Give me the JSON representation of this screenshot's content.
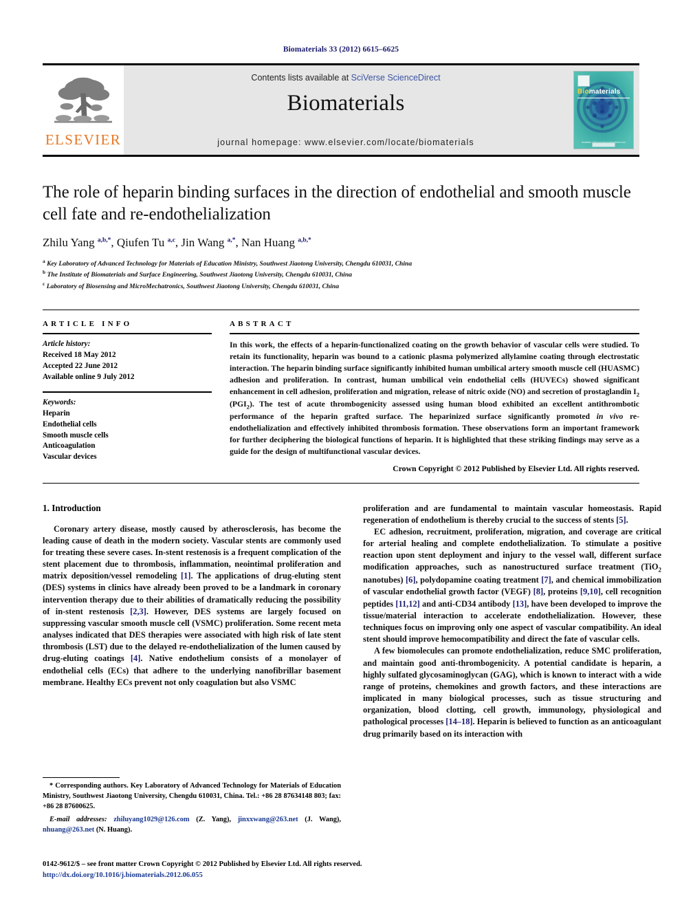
{
  "running_head": "Biomaterials 33 (2012) 6615–6625",
  "masthead": {
    "publisher_logo_word": "ELSEVIER",
    "contents_prefix": "Contents lists available at ",
    "contents_link": "SciVerse ScienceDirect",
    "journal_title": "Biomaterials",
    "homepage": "journal homepage: www.elsevier.com/locate/biomaterials",
    "cover": {
      "title_part1": "Bio",
      "title_part2": "materials",
      "footer_text": "Available online at www.sciencedirect.com",
      "teal": "#3aa8a0",
      "yellow": "#f4d03f"
    }
  },
  "article": {
    "title": "The role of heparin binding surfaces in the direction of endothelial and smooth muscle cell fate and re-endothelialization",
    "authors_html": "Zhilu Yang <sup>a,b,</sup><sup>*</sup>, Qiufen Tu <sup>a,c</sup>, Jin Wang <sup>a,</sup><sup>*</sup>, Nan Huang <sup>a,b,</sup><sup>*</sup>",
    "affiliations": [
      {
        "marker": "a",
        "text": "Key Laboratory of Advanced Technology for Materials of Education Ministry, Southwest Jiaotong University, Chengdu 610031, China"
      },
      {
        "marker": "b",
        "text": "The Institute of Biomaterials and Surface Engineering, Southwest Jiaotong University, Chengdu 610031, China"
      },
      {
        "marker": "c",
        "text": "Laboratory of Biosensing and MicroMechatronics, Southwest Jiaotong University, Chengdu 610031, China"
      }
    ]
  },
  "article_info": {
    "heading": "ARTICLE INFO",
    "history_label": "Article history:",
    "history": [
      "Received 18 May 2012",
      "Accepted 22 June 2012",
      "Available online 9 July 2012"
    ],
    "keywords_label": "Keywords:",
    "keywords": [
      "Heparin",
      "Endothelial cells",
      "Smooth muscle cells",
      "Anticoagulation",
      "Vascular devices"
    ]
  },
  "abstract": {
    "heading": "ABSTRACT",
    "text_html": "In this work, the effects of a heparin-functionalized coating on the growth behavior of vascular cells were studied. To retain its functionality, heparin was bound to a cationic plasma polymerized allylamine coating through electrostatic interaction. The heparin binding surface significantly inhibited human umbilical artery smooth muscle cell (HUASMC) adhesion and proliferation. In contrast, human umbilical vein endothelial cells (HUVECs) showed significant enhancement in cell adhesion, proliferation and migration, release of nitric oxide (NO) and secretion of prostaglandin I<sub>2</sub> (PGI<sub>2</sub>). The test of acute thrombogenicity assessed using human blood exhibited an excellent antithrombotic performance of the heparin grafted surface. The heparinized surface significantly promoted <i>in vivo</i> re-endothelialization and effectively inhibited thrombosis formation. These observations form an important framework for further deciphering the biological functions of heparin. It is highlighted that these striking findings may serve as a guide for the design of multifunctional vascular devices.",
    "copyright": "Crown Copyright © 2012 Published by Elsevier Ltd. All rights reserved."
  },
  "body": {
    "section_title": "1. Introduction",
    "left_paragraphs_html": [
      "Coronary artery disease, mostly caused by atherosclerosis, has become the leading cause of death in the modern society. Vascular stents are commonly used for treating these severe cases. In-stent restenosis is a frequent complication of the stent placement due to thrombosis, inflammation, neointimal proliferation and matrix deposition/vessel remodeling <span class=\"ref\">[1]</span>. The applications of drug-eluting stent (DES) systems in clinics have already been proved to be a landmark in coronary intervention therapy due to their abilities of dramatically reducing the possibility of in-stent restenosis <span class=\"ref\">[2,3]</span>. However, DES systems are largely focused on suppressing vascular smooth muscle cell (VSMC) proliferation. Some recent meta analyses indicated that DES therapies were associated with high risk of late stent thrombosis (LST) due to the delayed re-endothelialization of the lumen caused by drug-eluting coatings <span class=\"ref\">[4]</span>. Native endothelium consists of a monolayer of endothelial cells (ECs) that adhere to the underlying nanofibrillar basement membrane. Healthy ECs prevent not only coagulation but also VSMC"
    ],
    "right_paragraphs_html": [
      "proliferation and are fundamental to maintain vascular homeostasis. Rapid regeneration of endothelium is thereby crucial to the success of stents <span class=\"ref\">[5]</span>.",
      "EC adhesion, recruitment, proliferation, migration, and coverage are critical for arterial healing and complete endothelialization. To stimulate a positive reaction upon stent deployment and injury to the vessel wall, different surface modification approaches, such as nanostructured surface treatment (TiO<sub>2</sub> nanotubes) <span class=\"ref\">[6]</span>, polydopamine coating treatment <span class=\"ref\">[7]</span>, and chemical immobilization of vascular endothelial growth factor (VEGF) <span class=\"ref\">[8]</span>, proteins <span class=\"ref\">[9,10]</span>, cell recognition peptides <span class=\"ref\">[11,12]</span> and anti-CD34 antibody <span class=\"ref\">[13]</span>, have been developed to improve the tissue/material interaction to accelerate endothelialization. However, these techniques focus on improving only one aspect of vascular compatibility. An ideal stent should improve hemocompatibility and direct the fate of vascular cells.",
      "A few biomolecules can promote endothelialization, reduce SMC proliferation, and maintain good anti-thrombogenicity. A potential candidate is heparin, a highly sulfated glycosaminoglycan (GAG), which is known to interact with a wide range of proteins, chemokines and growth factors, and these interactions are implicated in many biological processes, such as tissue structuring and organization, blood clotting, cell growth, immunology, physiological and pathological processes <span class=\"ref\">[14–18]</span>. Heparin is believed to function as an anticoagulant drug primarily based on its interaction with"
    ]
  },
  "footnotes": {
    "corresponding_html": "<span class=\"lead\">*</span> Corresponding authors. Key Laboratory of Advanced Technology for Materials of Education Ministry, Southwest Jiaotong University, Chengdu 610031, China. Tel.: +86 28 87634148 803; fax: +86 28 87600625.",
    "email_label": "E-mail addresses:",
    "emails_html": "<span class=\"link\">zhiluyang1029@126.com</span> (Z. Yang), <span class=\"link\">jinxxwang@263.net</span> (J. Wang), <span class=\"link\">nhuang@263.net</span> (N. Huang)."
  },
  "bottom": {
    "issn_line": "0142-9612/$ – see front matter Crown Copyright © 2012 Published by Elsevier Ltd. All rights reserved.",
    "doi": "http://dx.doi.org/10.1016/j.biomaterials.2012.06.055"
  }
}
